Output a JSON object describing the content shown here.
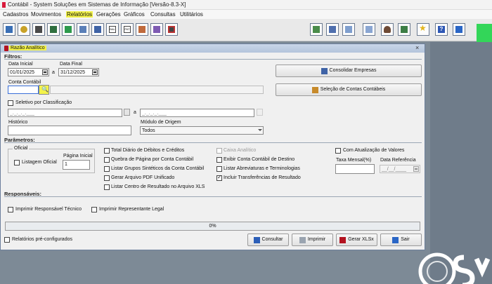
{
  "window": {
    "title": "Contábil - System Soluções em Sistemas de Informação [Versão-8.3-X]"
  },
  "menu": [
    {
      "label": "Cadastros"
    },
    {
      "label": "Movimentos"
    },
    {
      "label": "Relatórios"
    },
    {
      "label": "Gerações"
    },
    {
      "label": "Gráficos"
    },
    {
      "label": "Consultas"
    },
    {
      "label": "Utilitários"
    }
  ],
  "toolbar": {
    "icons_left": [
      "table-icon",
      "coins-icon",
      "cash-register-icon",
      "ledger-icon",
      "export-icon",
      "calendar-icon",
      "bank-icon",
      "bal-icon",
      "pat-icon",
      "grid-icon",
      "cube-icon",
      "screen-icon"
    ],
    "icon_text": {
      "bal": "BAL",
      "pat": "PAT"
    },
    "icons_right": [
      "calendar-check-icon",
      "document-list-icon",
      "notepad-icon",
      "window-icon",
      "user-icon",
      "books-icon",
      "star-icon",
      "help-icon",
      "exit-door-icon"
    ]
  },
  "dialog": {
    "title": "Razão Analítico",
    "sections": {
      "filtros": "Filtros:",
      "parametros": "Parâmetros:",
      "responsaveis": "Responsáveis:"
    },
    "data_inicial": {
      "label": "Data Inicial",
      "value": "01/01/2025"
    },
    "data_separator": "a",
    "data_final": {
      "label": "Data Final",
      "value": "31/12/2025"
    },
    "conta_contabil": {
      "label": "Conta Contábil",
      "value": ""
    },
    "consolidar_button": "Consolidar Empresas",
    "selecao_contas_button": "Seleção de Contas Contábeis",
    "seletivo": {
      "label": "Seletivo por Classificação",
      "checked": false
    },
    "classificacao_de": "_._._._.___",
    "classificacao_sep": "a",
    "classificacao_ate": "_._._._.___",
    "historico": {
      "label": "Histórico",
      "value": ""
    },
    "modulo_origem": {
      "label": "Módulo de Origem",
      "value": "Todos"
    },
    "oficial": {
      "group_label": "Oficial",
      "listagem_label": "Listagem Oficial",
      "listagem_checked": false,
      "pagina_label": "Página Inicial",
      "pagina_value": "1"
    },
    "options_col1": [
      {
        "label": "Total Diário de Débitos e Créditos",
        "checked": false
      },
      {
        "label": "Quebra de Página por Conta Contábil",
        "checked": false
      },
      {
        "label": "Listar Grupos Sintéticos da Conta Contábil",
        "checked": false
      },
      {
        "label": "Gerar Arquivo PDF Unificado",
        "checked": false
      },
      {
        "label": "Listar Centro de Resultado no Arquivo XLS",
        "checked": false
      }
    ],
    "options_col2": [
      {
        "label": "Caixa Analítico",
        "checked": false,
        "disabled": true
      },
      {
        "label": "Exibir Conta Contábil de Destino",
        "checked": false
      },
      {
        "label": "Listar Abreviaturas e Terminologias",
        "checked": false
      },
      {
        "label": "Incluir Transferências de Resultado",
        "checked": true
      }
    ],
    "com_atualizacao": {
      "label": "Com Atualização de Valores",
      "checked": false
    },
    "taxa_mensal": {
      "label": "Taxa Mensal(%)",
      "value": ""
    },
    "data_referencia": {
      "label": "Data Referência",
      "value": "__/__/____"
    },
    "imprimir_responsavel": {
      "label": "Imprimir Responsável Técnico",
      "checked": false
    },
    "imprimir_representante": {
      "label": "Imprimir Representante Legal",
      "checked": false
    },
    "progress": {
      "text": "0%",
      "value": 0
    },
    "relatorios_preconfig": {
      "label": "Relatórios pré-configurados",
      "checked": false
    },
    "buttons": {
      "consultar": "Consultar",
      "imprimir": "Imprimir",
      "gerar_xlsx": "Gerar XLSx",
      "sair": "Sair"
    }
  },
  "colors": {
    "highlight": "#f3f34a",
    "dialog_bg": "#f0f0f0",
    "title_gradient": "#b3c4dc",
    "accent_green": "#33d659",
    "app_red": "#d81b3c"
  }
}
